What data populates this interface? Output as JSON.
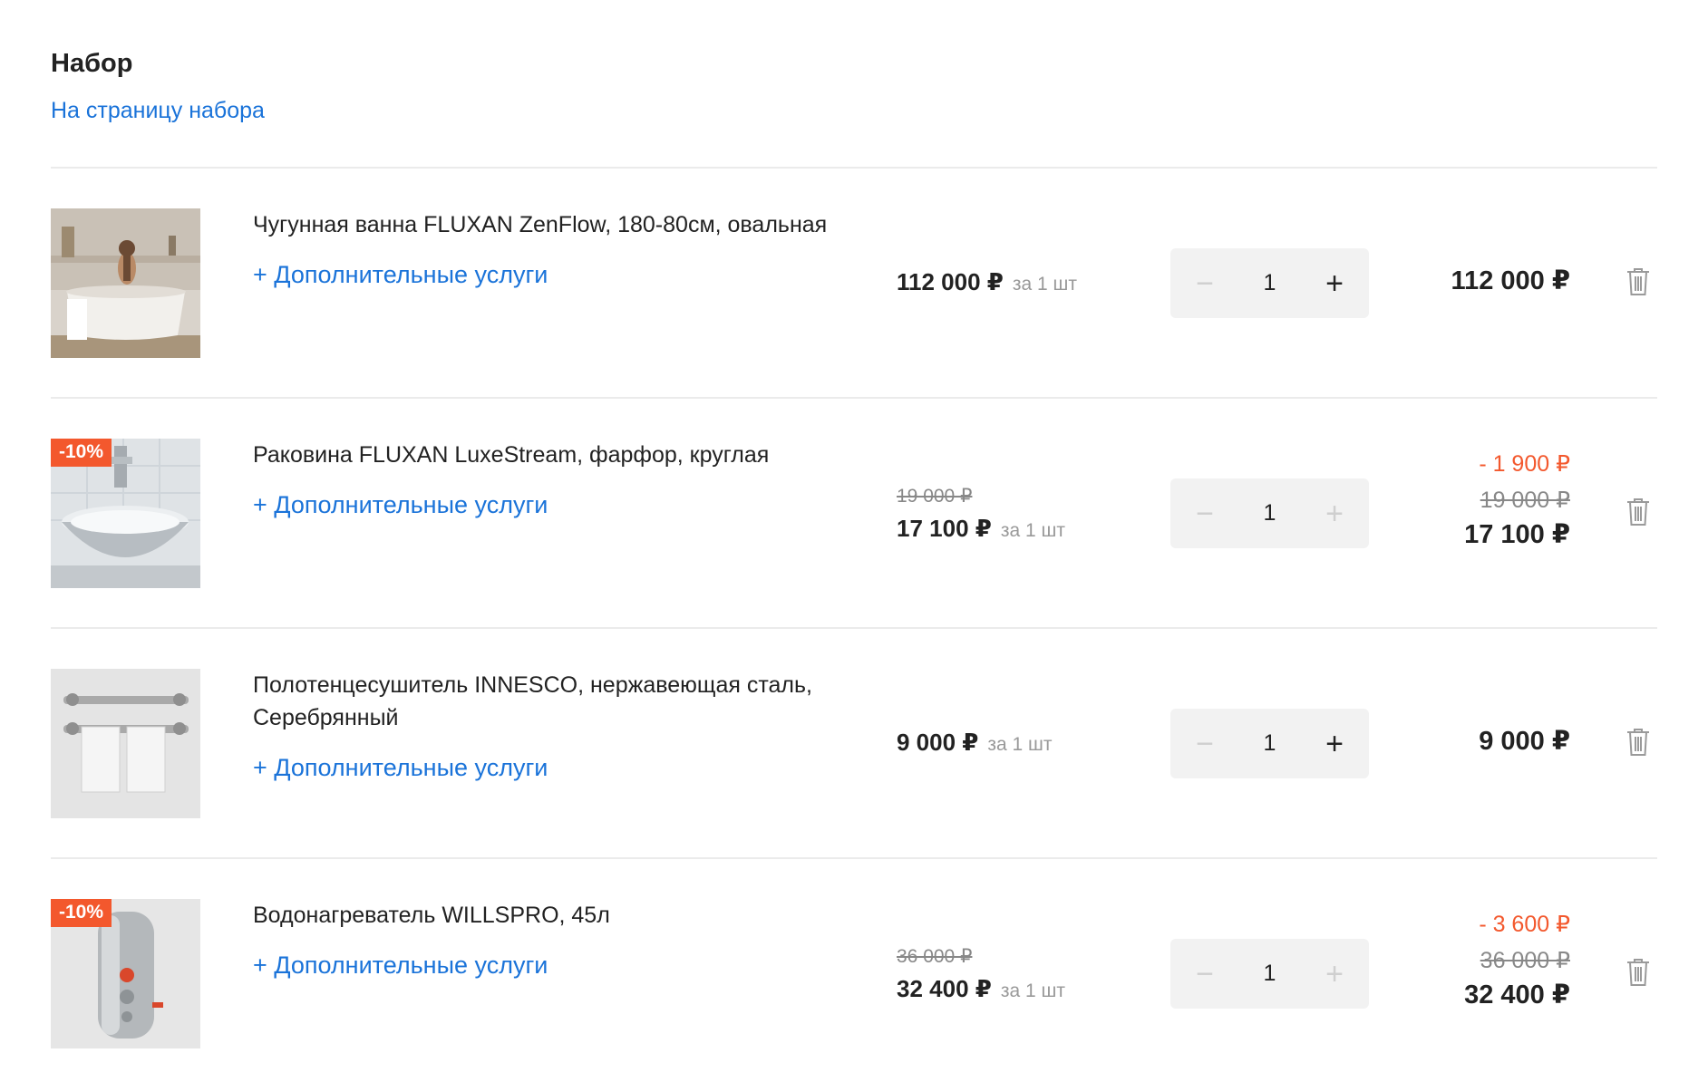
{
  "set": {
    "title": "Набор",
    "link": "На страницу набора"
  },
  "items": [
    {
      "name": "Чугунная ванна FLUXAN ZenFlow, 180-80см, овальная",
      "services": "+ Дополнительные услуги",
      "unit_price": "112 000 ₽",
      "per_unit": "за 1 шт",
      "quantity": "1",
      "minus": "−",
      "plus": "+",
      "total": "112 000 ₽",
      "image_icon": "bathtub-photo"
    },
    {
      "badge": "-10%",
      "name": "Раковина FLUXAN LuxeStream, фарфор, круглая",
      "services": "+ Дополнительные услуги",
      "unit_old_price": "19 000 ₽",
      "unit_price": "17 100 ₽",
      "per_unit": "за 1 шт",
      "quantity": "1",
      "minus": "−",
      "plus": "+",
      "total_discount": "- 1 900 ₽",
      "total_old": "19 000 ₽",
      "total": "17 100 ₽",
      "image_icon": "sink-photo"
    },
    {
      "name": "Полотенцесушитель INNESCO, нержавеющая сталь, Серебрянный",
      "services": "+ Дополнительные услуги",
      "unit_price": "9 000 ₽",
      "per_unit": "за 1 шт",
      "quantity": "1",
      "minus": "−",
      "plus": "+",
      "total": "9 000 ₽",
      "image_icon": "towel-rail-photo"
    },
    {
      "badge": "-10%",
      "name": "Водонагреватель WILLSPRO, 45л",
      "services": "+ Дополнительные услуги",
      "unit_old_price": "36 000 ₽",
      "unit_price": "32 400 ₽",
      "per_unit": "за 1 шт",
      "quantity": "1",
      "minus": "−",
      "plus": "+",
      "total_discount": "- 3 600 ₽",
      "total_old": "36 000 ₽",
      "total": "32 400 ₽",
      "image_icon": "water-heater-photo"
    }
  ],
  "colors": {
    "link": "#1a73d9",
    "badge": "#f3582d",
    "discount": "#f3582d",
    "qty_bg": "#f2f2f2"
  }
}
